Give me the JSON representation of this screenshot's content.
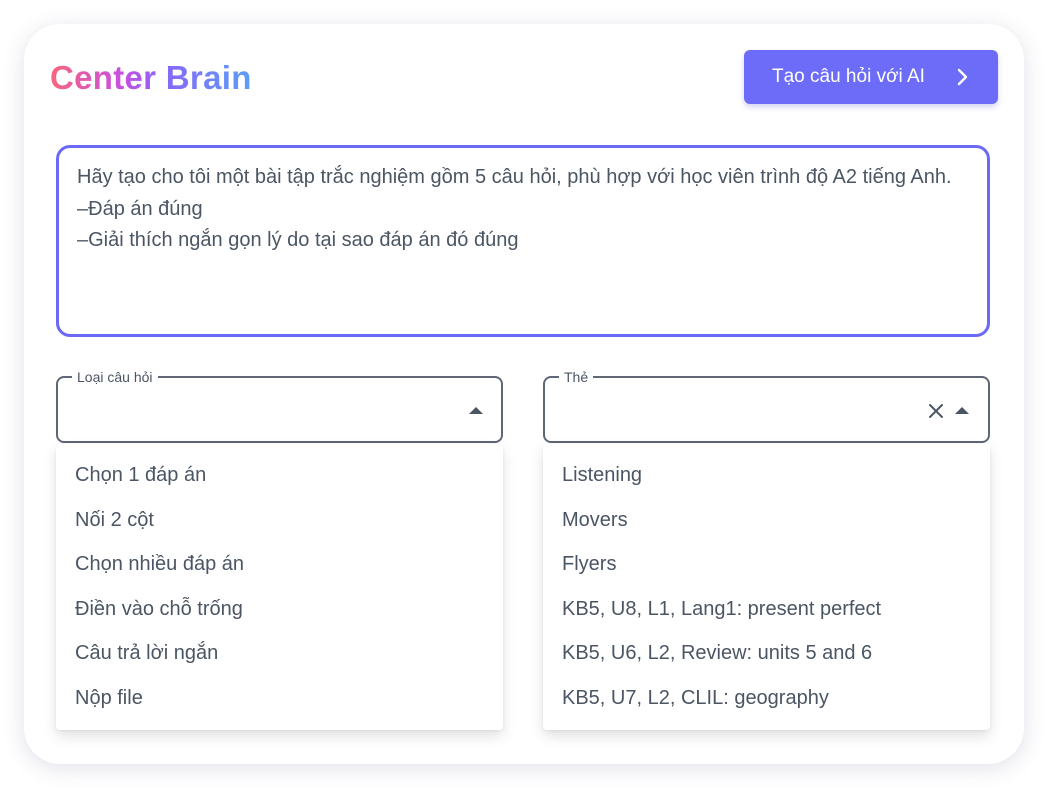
{
  "brand": {
    "name_part1": "Center ",
    "name_part2": "Brain"
  },
  "header": {
    "ai_button_label": "Tạo câu hỏi với AI",
    "ai_button_icon": "chevron-right-icon"
  },
  "prompt": {
    "value": "Hãy tạo cho tôi một bài tập trắc nghiệm gồm 5 câu hỏi, phù hợp với học viên trình độ A2 tiếng Anh.\n–Đáp án đúng\n–Giải thích ngắn gọn lý do tại sao đáp án đó đúng"
  },
  "question_type": {
    "label": "Loại câu hỏi",
    "value": "",
    "options": [
      "Chọn 1 đáp án",
      "Nối 2 cột",
      "Chọn nhiều đáp án",
      "Điền vào chỗ trống",
      "Câu trả lời ngắn",
      "Nộp file"
    ]
  },
  "tags": {
    "label": "Thẻ",
    "value": "",
    "options": [
      "Listening",
      "Movers",
      "Flyers",
      "KB5, U8, L1, Lang1: present perfect",
      "KB5, U6, L2, Review: units 5 and 6",
      "KB5, U7, L2, CLIL: geography"
    ]
  },
  "colors": {
    "accent": "#6c6cf9",
    "border": "#5f6776",
    "text": "#4b5563"
  }
}
